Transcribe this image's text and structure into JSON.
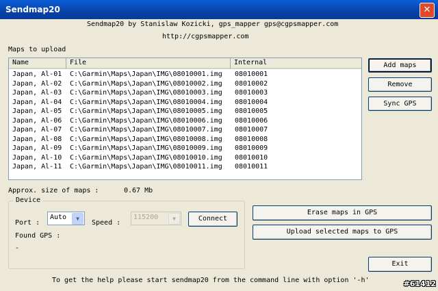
{
  "window": {
    "title": "Sendmap20",
    "close_glyph": "✕"
  },
  "header": {
    "credits": "Sendmap20 by Stanislaw Kozicki, gps_mapper gps@cgpsmapper.com",
    "url": "http://cgpsmapper.com"
  },
  "maps_label": "Maps to upload",
  "table": {
    "columns": [
      "Name",
      "File",
      "Internal"
    ],
    "rows": [
      [
        "Japan, Al-01",
        "C:\\Garmin\\Maps\\Japan\\IMG\\08010001.img",
        "08010001"
      ],
      [
        "Japan, Al-02",
        "C:\\Garmin\\Maps\\Japan\\IMG\\08010002.img",
        "08010002"
      ],
      [
        "Japan, Al-03",
        "C:\\Garmin\\Maps\\Japan\\IMG\\08010003.img",
        "08010003"
      ],
      [
        "Japan, Al-04",
        "C:\\Garmin\\Maps\\Japan\\IMG\\08010004.img",
        "08010004"
      ],
      [
        "Japan, Al-05",
        "C:\\Garmin\\Maps\\Japan\\IMG\\08010005.img",
        "08010005"
      ],
      [
        "Japan, Al-06",
        "C:\\Garmin\\Maps\\Japan\\IMG\\08010006.img",
        "08010006"
      ],
      [
        "Japan, Al-07",
        "C:\\Garmin\\Maps\\Japan\\IMG\\08010007.img",
        "08010007"
      ],
      [
        "Japan, Al-08",
        "C:\\Garmin\\Maps\\Japan\\IMG\\08010008.img",
        "08010008"
      ],
      [
        "Japan, Al-09",
        "C:\\Garmin\\Maps\\Japan\\IMG\\08010009.img",
        "08010009"
      ],
      [
        "Japan, Al-10",
        "C:\\Garmin\\Maps\\Japan\\IMG\\08010010.img",
        "08010010"
      ],
      [
        "Japan, Al-11",
        "C:\\Garmin\\Maps\\Japan\\IMG\\08010011.img",
        "08010011"
      ]
    ]
  },
  "buttons": {
    "add_maps": "Add maps",
    "remove": "Remove",
    "sync_gps": "Sync GPS",
    "connect": "Connect",
    "erase": "Erase maps in GPS",
    "upload": "Upload selected maps to GPS",
    "exit": "Exit"
  },
  "size": {
    "label": "Approx. size of maps :",
    "value": "0.67 Mb"
  },
  "device": {
    "legend": "Device",
    "port_label": "Port :",
    "port_value": "Auto",
    "speed_label": "Speed :",
    "speed_value": "115200",
    "found_label": "Found GPS :",
    "found_value": "-"
  },
  "help_text": "To get the help please start sendmap20 from the command line with option '-h'",
  "watermark": "#61412",
  "colors": {
    "titlebar": "#0a5fd8",
    "window_bg": "#ece9d8",
    "close": "#e04a2a"
  }
}
